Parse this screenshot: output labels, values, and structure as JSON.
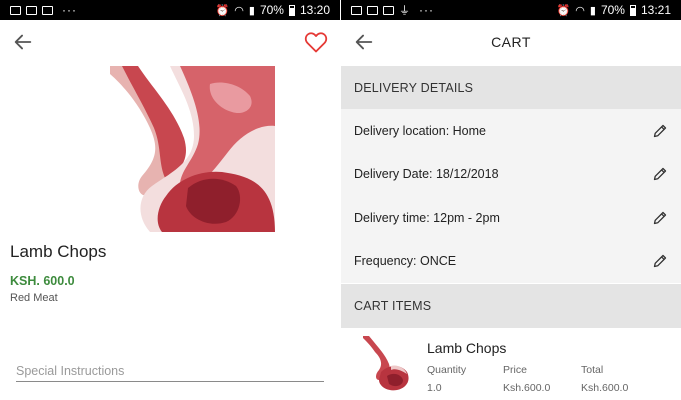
{
  "status_left": {
    "time": "13:20",
    "battery": "70%"
  },
  "status_right": {
    "time": "13:21",
    "battery": "70%"
  },
  "product": {
    "name": "Lamb Chops",
    "price": "KSH. 600.0",
    "category": "Red Meat",
    "instructions_placeholder": "Special Instructions",
    "image_icon": "lamb-chop-image"
  },
  "cart": {
    "title": "CART",
    "delivery_header": "DELIVERY DETAILS",
    "details": [
      {
        "label": "Delivery location: Home"
      },
      {
        "label": "Delivery Date: 18/12/2018"
      },
      {
        "label": "Delivery time: 12pm - 2pm"
      },
      {
        "label": "Frequency: ONCE"
      }
    ],
    "items_header": "CART ITEMS",
    "item": {
      "name": "Lamb Chops",
      "quantity_label": "Quantity",
      "price_label": "Price",
      "total_label": "Total",
      "quantity": "1.0",
      "price": "Ksh.600.0",
      "total": "Ksh.600.0"
    }
  },
  "colors": {
    "price_green": "#3d8b3d",
    "heart_red": "#e53935",
    "section_grey": "#e4e4e4"
  }
}
